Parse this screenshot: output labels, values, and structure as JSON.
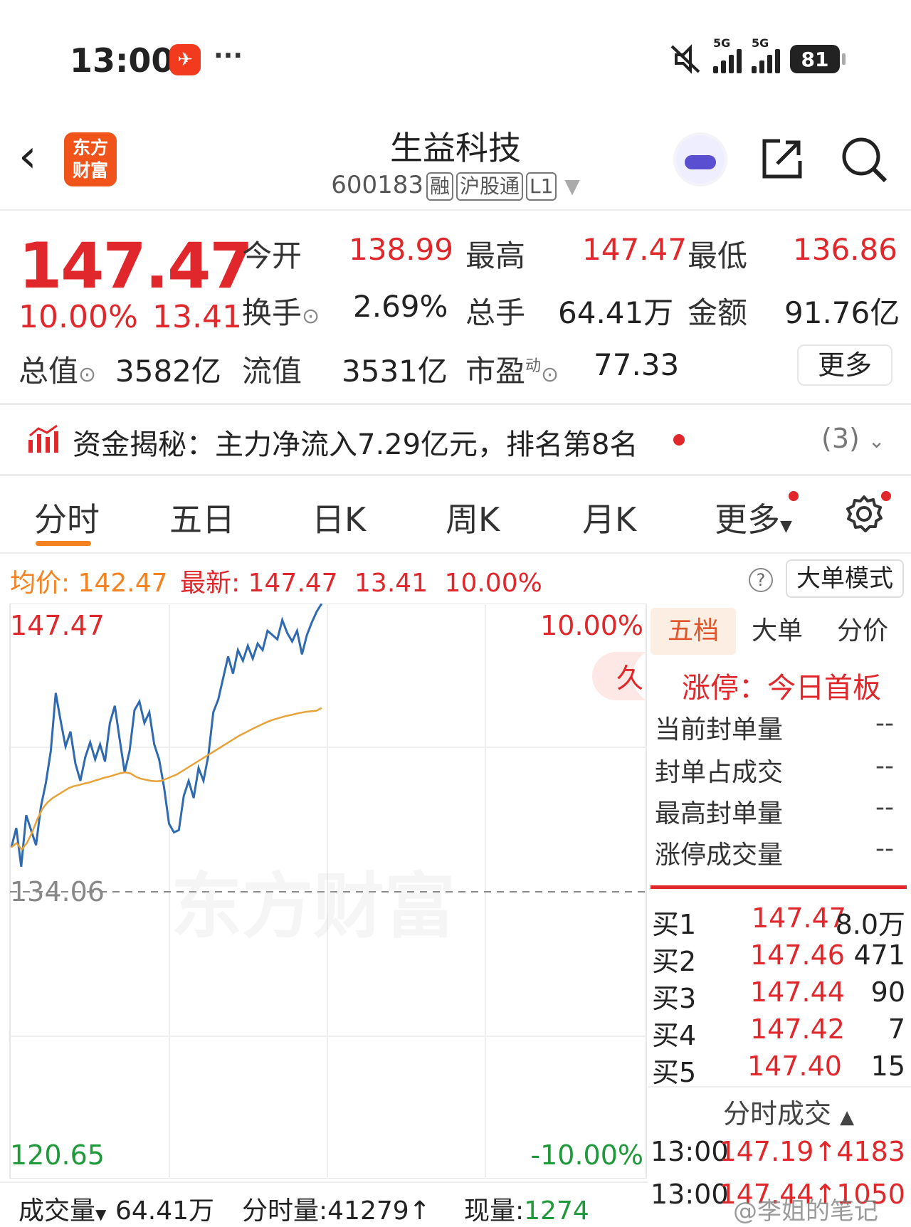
{
  "status_bar": {
    "time": "13:00",
    "app_icon": "toutiao-like-red-icon",
    "more": "···",
    "signal1_label": "5G",
    "signal2_label": "5G",
    "battery": "81",
    "icons": [
      "mute-icon",
      "signal-icon",
      "signal-icon",
      "battery-icon"
    ]
  },
  "header": {
    "back_icon": "back-chevron-icon",
    "logo_text": "东方财富",
    "title": "生益科技",
    "code": "600183",
    "tags": [
      "融",
      "沪股通",
      "L1"
    ],
    "dropdown_icon": "triangle-down-icon",
    "assistant_icon": "robot-assistant-icon",
    "share_icon": "share-icon",
    "search_icon": "search-icon"
  },
  "quote": {
    "price": "147.47",
    "change_pct": "10.00%",
    "change": "13.41",
    "open_label": "今开",
    "open": "138.99",
    "high_label": "最高",
    "high": "147.47",
    "low_label": "最低",
    "low": "136.86",
    "turnover_label": "换手",
    "turnover": "2.69%",
    "volume_label": "总手",
    "volume": "64.41万",
    "amount_label": "金额",
    "amount": "91.76亿",
    "mktcap_label": "总值",
    "mktcap": "3582亿",
    "float_label": "流值",
    "float": "3531亿",
    "pe_label": "市盈",
    "pe_sup": "动",
    "pe": "77.33",
    "more_button": "更多"
  },
  "capital": {
    "icon": "capital-flow-icon",
    "text": "资金揭秘：主力净流入7.29亿元，排名第8名",
    "count": "(3)",
    "chevron": "chevron-down-icon"
  },
  "tabs": [
    {
      "label": "分时",
      "active": true
    },
    {
      "label": "五日"
    },
    {
      "label": "日K"
    },
    {
      "label": "周K"
    },
    {
      "label": "月K"
    },
    {
      "label": "更多"
    }
  ],
  "settings_icon": "gear-icon",
  "info_line": {
    "avg_label": "均价:",
    "avg": "142.47",
    "latest_label": "最新:",
    "latest": "147.47",
    "change": "13.41",
    "pct": "10.00%",
    "help_icon": "help-icon",
    "mode_button": "大单模式"
  },
  "chart_labels": {
    "top_price": "147.47",
    "top_pct": "10.00%",
    "mid_price": "134.06",
    "bottom_price": "120.65",
    "bottom_pct": "-10.00%",
    "badge": "久",
    "watermark": "东方财富"
  },
  "chart_data": {
    "type": "line",
    "y_range": [
      120.65,
      147.47
    ],
    "prev_close": 134.06,
    "series": [
      {
        "values": [
          136.1,
          137.0,
          135.2,
          137.6,
          136.9,
          136.2,
          138.0,
          139.1,
          140.6,
          143.3,
          142.0,
          140.8,
          141.5,
          140.0,
          139.2,
          140.3,
          141.0,
          140.2,
          140.9,
          140.1,
          141.9,
          142.7,
          141.1,
          139.6,
          140.6,
          142.5,
          142.9,
          141.9,
          142.4,
          140.9,
          140.2,
          138.9,
          137.2,
          136.8,
          136.9,
          138.5,
          139.2,
          138.4,
          139.8,
          139.2,
          140.4,
          142.4,
          143.0,
          144.0,
          145.0,
          144.2,
          145.3,
          144.8,
          145.5,
          144.9,
          145.6,
          145.3,
          146.2,
          146.0,
          145.8,
          146.7,
          146.1,
          145.7,
          146.2,
          145.1,
          146.0,
          146.6,
          147.1,
          147.47
        ]
      },
      {
        "values": [
          136.1,
          136.3,
          136.0,
          136.3,
          136.8,
          137.4,
          137.9,
          138.2,
          138.4,
          138.55,
          138.7,
          138.85,
          138.95,
          139.0,
          139.07,
          139.12,
          139.2,
          139.27,
          139.35,
          139.4,
          139.48,
          139.55,
          139.6,
          139.55,
          139.4,
          139.3,
          139.25,
          139.2,
          139.18,
          139.2,
          139.3,
          139.4,
          139.5,
          139.65,
          139.8,
          139.95,
          140.1,
          140.25,
          140.4,
          140.55,
          140.7,
          140.85,
          141.0,
          141.15,
          141.3,
          141.42,
          141.55,
          141.67,
          141.78,
          141.9,
          142.0,
          142.08,
          142.15,
          142.22,
          142.27,
          142.33,
          142.38,
          142.42,
          142.45,
          142.47,
          142.6
        ]
      }
    ]
  },
  "right_panel": {
    "tabs": [
      "五档",
      "大单",
      "分价"
    ],
    "limit_title": "涨停：今日首板",
    "limit_rows": [
      {
        "label": "当前封单量",
        "value": "--"
      },
      {
        "label": "封单占成交",
        "value": "--"
      },
      {
        "label": "最高封单量",
        "value": "--"
      },
      {
        "label": "涨停成交量",
        "value": "--"
      }
    ],
    "bids": [
      {
        "label": "买1",
        "price": "147.47",
        "vol": "8.0万"
      },
      {
        "label": "买2",
        "price": "147.46",
        "vol": "471"
      },
      {
        "label": "买3",
        "price": "147.44",
        "vol": "90"
      },
      {
        "label": "买4",
        "price": "147.42",
        "vol": "7"
      },
      {
        "label": "买5",
        "price": "147.40",
        "vol": "15"
      }
    ],
    "fenshi_title": "分时成交",
    "ticks": [
      {
        "time": "13:00",
        "price": "147.19",
        "vol": "4183"
      },
      {
        "time": "13:00",
        "price": "147.44",
        "vol": "1050"
      }
    ]
  },
  "bottom": {
    "vol_label": "成交量",
    "vol_value": "64.41万",
    "fenshi_vol": "分时量:41279",
    "now_label": "现量:",
    "now_value": "1274",
    "watermark": "@李姐的笔记"
  },
  "colors": {
    "up": "#e0272b",
    "down": "#1f9a3a",
    "price_line": "#2f6ab1",
    "avg_line": "#e8a23a",
    "accent": "#f58220"
  }
}
